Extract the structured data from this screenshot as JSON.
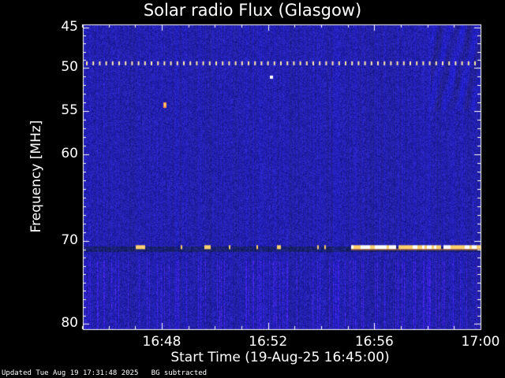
{
  "title": "Solar radio Flux (Glasgow)",
  "chart_data": {
    "type": "heatmap",
    "title": "Solar radio Flux (Glasgow)",
    "xlabel": "Start Time (19-Aug-25 16:45:00)",
    "ylabel": "Frequency [MHz]",
    "xlim": [
      "16:45",
      "17:00"
    ],
    "ylim": [
      80,
      45
    ],
    "x_tick_labels": [
      "16:48",
      "16:52",
      "16:56",
      "17:00"
    ],
    "y_tick_labels": [
      "45",
      "50",
      "55",
      "60",
      "70",
      "80"
    ],
    "note": "BG subtracted",
    "features": [
      {
        "kind": "dashed-interference-line",
        "frequency_mhz": 49.5,
        "time_start": "16:45",
        "time_end": "17:00"
      },
      {
        "kind": "interference-band",
        "frequency_mhz": 70.8,
        "time_start": "16:47",
        "time_end": "17:00"
      }
    ]
  },
  "footer": {
    "updated": "Updated Tue Aug 19 17:31:48 2025",
    "note": "BG subtracted"
  },
  "colors": {
    "background": "#000000",
    "plot_base": "#1a1a9a",
    "accent_hot": "#ffd070"
  }
}
